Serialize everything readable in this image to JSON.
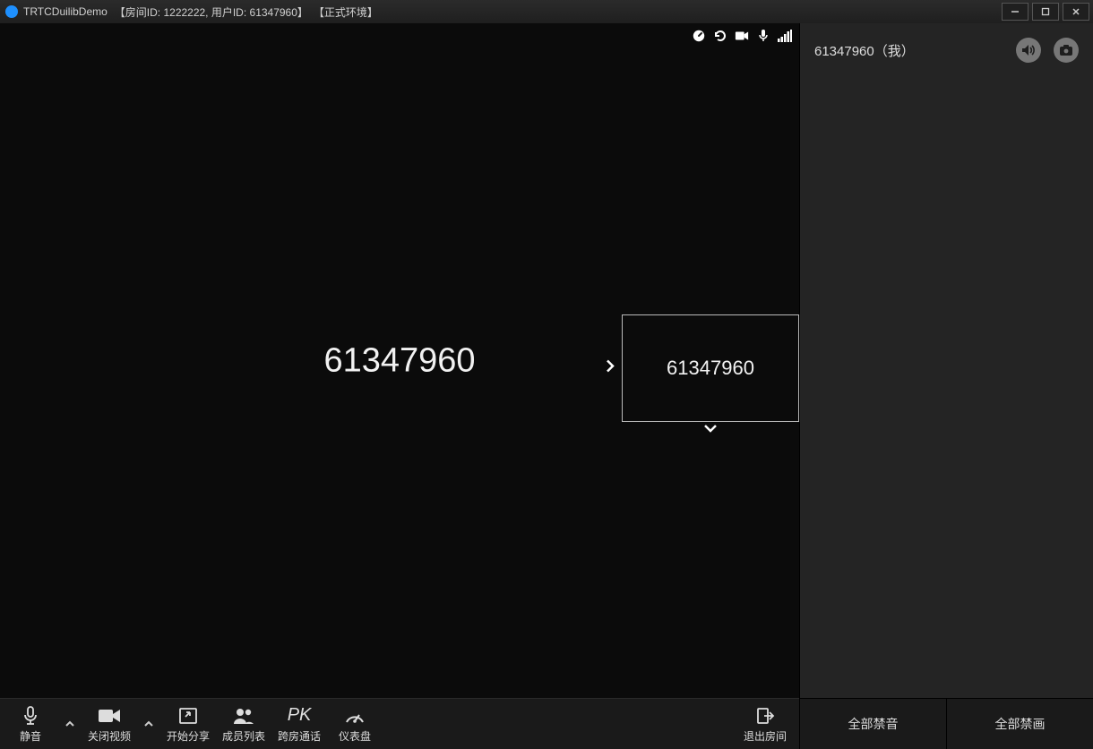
{
  "titlebar": {
    "app_name": "TRTCDuilibDemo",
    "room_info": "【房间ID: 1222222, 用户ID: 61347960】",
    "env": "【正式环境】"
  },
  "video": {
    "main_user_id": "61347960",
    "pip_user_id": "61347960"
  },
  "status_icons": [
    "dashboard",
    "refresh",
    "camera",
    "mic",
    "signal"
  ],
  "toolbar": {
    "mute": "静音",
    "close_video": "关闭视频",
    "share": "开始分享",
    "members": "成员列表",
    "cross_room": "跨房通话",
    "dashboard": "仪表盘",
    "exit": "退出房间",
    "pk": "PK"
  },
  "sidebar": {
    "participant_label": "61347960（我）",
    "mute_all": "全部禁音",
    "block_all_video": "全部禁画"
  }
}
